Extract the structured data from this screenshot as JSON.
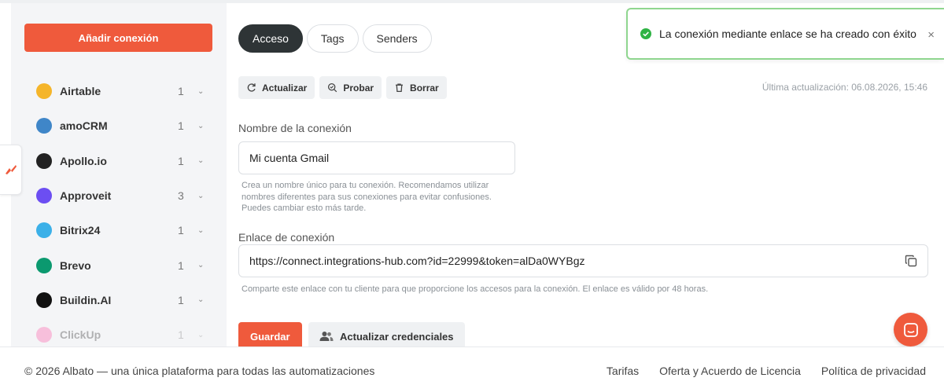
{
  "sidebar": {
    "add_button": "Añadir conexión",
    "items": [
      {
        "name": "Airtable",
        "count": "1",
        "icon": "airtable-icon",
        "color": "#f5b52a",
        "faded": false
      },
      {
        "name": "amoCRM",
        "count": "1",
        "icon": "amocrm-icon",
        "color": "#3f86c8",
        "faded": false
      },
      {
        "name": "Apollo.io",
        "count": "1",
        "icon": "apollo-icon",
        "color": "#222222",
        "faded": false
      },
      {
        "name": "Approveit",
        "count": "3",
        "icon": "approveit-icon",
        "color": "#6c4ef2",
        "faded": false
      },
      {
        "name": "Bitrix24",
        "count": "1",
        "icon": "bitrix24-icon",
        "color": "#3bb0e8",
        "faded": false
      },
      {
        "name": "Brevo",
        "count": "1",
        "icon": "brevo-icon",
        "color": "#0b996f",
        "faded": false
      },
      {
        "name": "Buildin.AI",
        "count": "1",
        "icon": "buildin-icon",
        "color": "#111111",
        "faded": false
      },
      {
        "name": "ClickUp",
        "count": "1",
        "icon": "clickup-icon",
        "color": "#ff5ca8",
        "faded": true
      }
    ]
  },
  "tabs": [
    {
      "label": "Acceso",
      "active": true
    },
    {
      "label": "Tags",
      "active": false
    },
    {
      "label": "Senders",
      "active": false
    }
  ],
  "actions": {
    "refresh": "Actualizar",
    "test": "Probar",
    "delete": "Borrar"
  },
  "last_update": "Última actualización: 06.08.2026, 15:46",
  "connection_name": {
    "label": "Nombre de la conexión",
    "value": "Mi cuenta Gmail",
    "hint_lines": [
      "Crea un nombre único para tu conexión. Recomendamos utilizar",
      "nombres diferentes para sus conexiones para evitar confusiones.",
      "Puedes cambiar esto más tarde."
    ]
  },
  "connection_link": {
    "label": "Enlace de conexión",
    "value": "https://connect.integrations-hub.com?id=22999&token=alDa0WYBgz",
    "hint": "Comparte este enlace con tu cliente para que proporcione los accesos para la conexión. El enlace es válido por 48 horas."
  },
  "buttons": {
    "save": "Guardar",
    "update_credentials": "Actualizar credenciales"
  },
  "toast": {
    "message": "La conexión mediante enlace se ha creado con éxito",
    "close": "×"
  },
  "footer": {
    "copyright": "© 2026 Albato — una única plataforma para todas las automatizaciones",
    "links": [
      "Tarifas",
      "Oferta y Acuerdo de Licencia",
      "Política de privacidad"
    ]
  },
  "colors": {
    "accent": "#ef5a3c",
    "tab_active": "#2e3436",
    "success": "#2fb344"
  }
}
